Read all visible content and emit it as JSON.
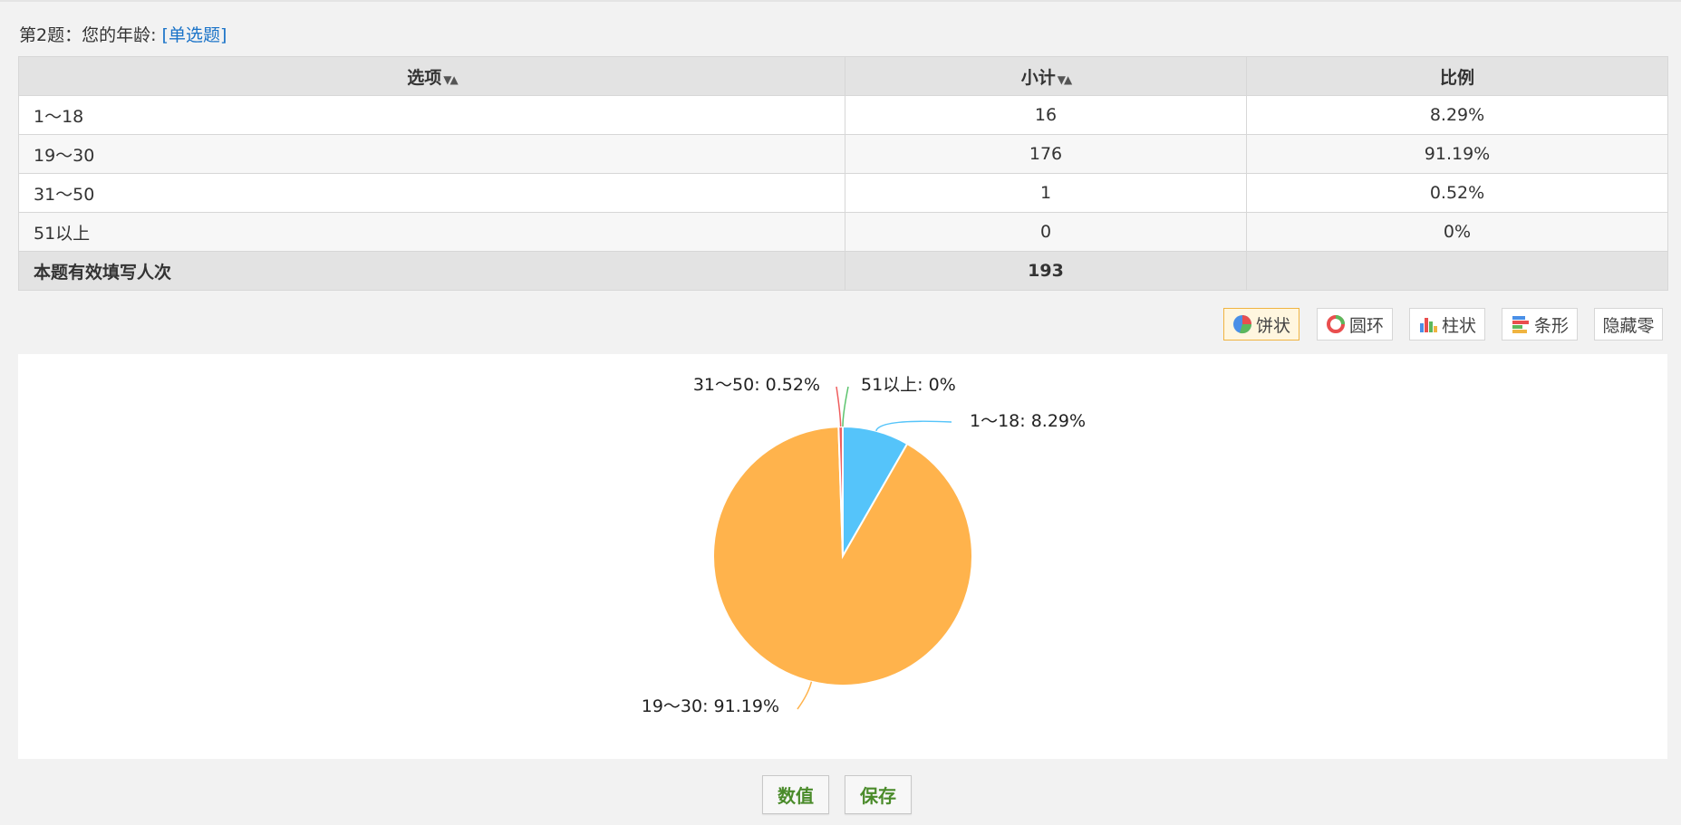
{
  "question": {
    "label": "第2题：您的年龄:",
    "type_tag": "[单选题]"
  },
  "table": {
    "headers": {
      "option": "选项",
      "count": "小计",
      "ratio": "比例"
    },
    "rows": [
      {
        "option": "1～18",
        "count": "16",
        "ratio": "8.29%"
      },
      {
        "option": "19～30",
        "count": "176",
        "ratio": "91.19%"
      },
      {
        "option": "31～50",
        "count": "1",
        "ratio": "0.52%"
      },
      {
        "option": "51以上",
        "count": "0",
        "ratio": "0%"
      }
    ],
    "total": {
      "label": "本题有效填写人次",
      "count": "193"
    }
  },
  "toolbar": {
    "pie": "饼状",
    "donut": "圆环",
    "column": "柱状",
    "bar": "条形",
    "hide_zero": "隐藏零"
  },
  "chart_data": {
    "type": "pie",
    "categories": [
      "1～18",
      "19～30",
      "31～50",
      "51以上"
    ],
    "values": [
      8.29,
      91.19,
      0.52,
      0
    ],
    "colors": [
      "#55c4fa",
      "#ffb34c",
      "#ef5e5e",
      "#5cc46e"
    ],
    "labels": [
      "1～18: 8.29%",
      "19～30: 91.19%",
      "31～50: 0.52%",
      "51以上: 0%"
    ],
    "unit": "%"
  },
  "buttons": {
    "values": "数值",
    "save": "保存"
  },
  "colors": {
    "link": "#1a73c8",
    "active_border": "#f0b441",
    "button_text": "#4a8b2a"
  }
}
